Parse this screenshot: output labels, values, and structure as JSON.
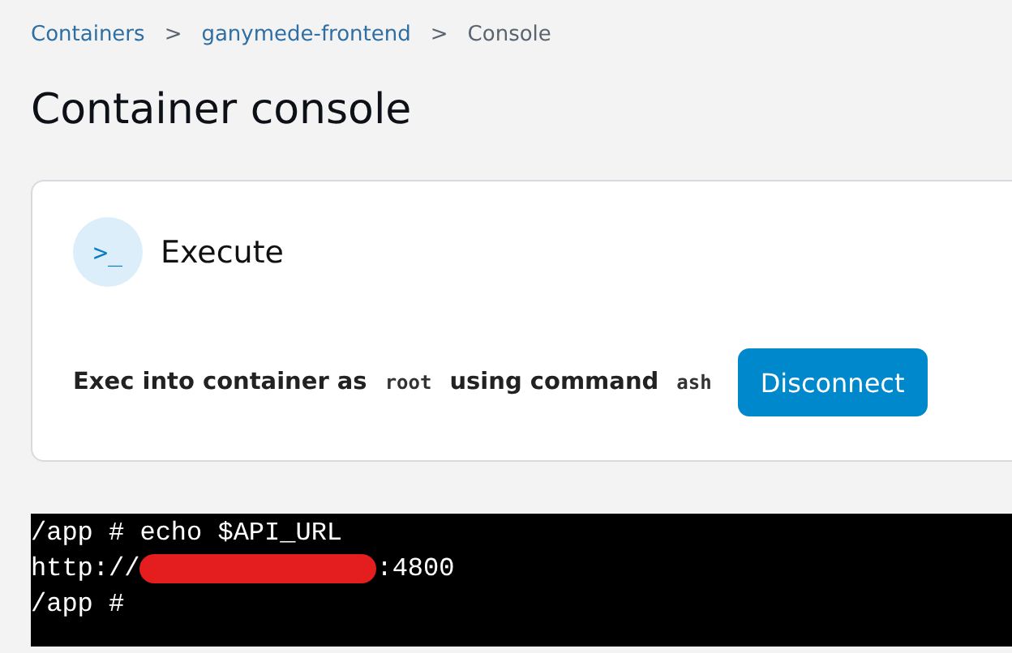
{
  "breadcrumb": [
    {
      "label": "Containers",
      "link": true
    },
    {
      "label": "ganymede-frontend",
      "link": true
    },
    {
      "label": "Console",
      "link": false
    }
  ],
  "separator": ">",
  "title": "Container console",
  "card": {
    "heading": "Execute",
    "icon_text": ">_",
    "description": [
      {
        "text": "Exec into container as",
        "kind": "text"
      },
      {
        "text": "root",
        "kind": "code"
      },
      {
        "text": "using command",
        "kind": "text"
      },
      {
        "text": "ash",
        "kind": "code"
      }
    ],
    "button": "Disconnect"
  },
  "terminal": {
    "lines": [
      {
        "before": "/app # echo $API_URL",
        "redacted": false
      },
      {
        "before": "http://",
        "redacted": true,
        "after": ":4800"
      },
      {
        "before": "/app #",
        "redacted": false
      }
    ]
  }
}
